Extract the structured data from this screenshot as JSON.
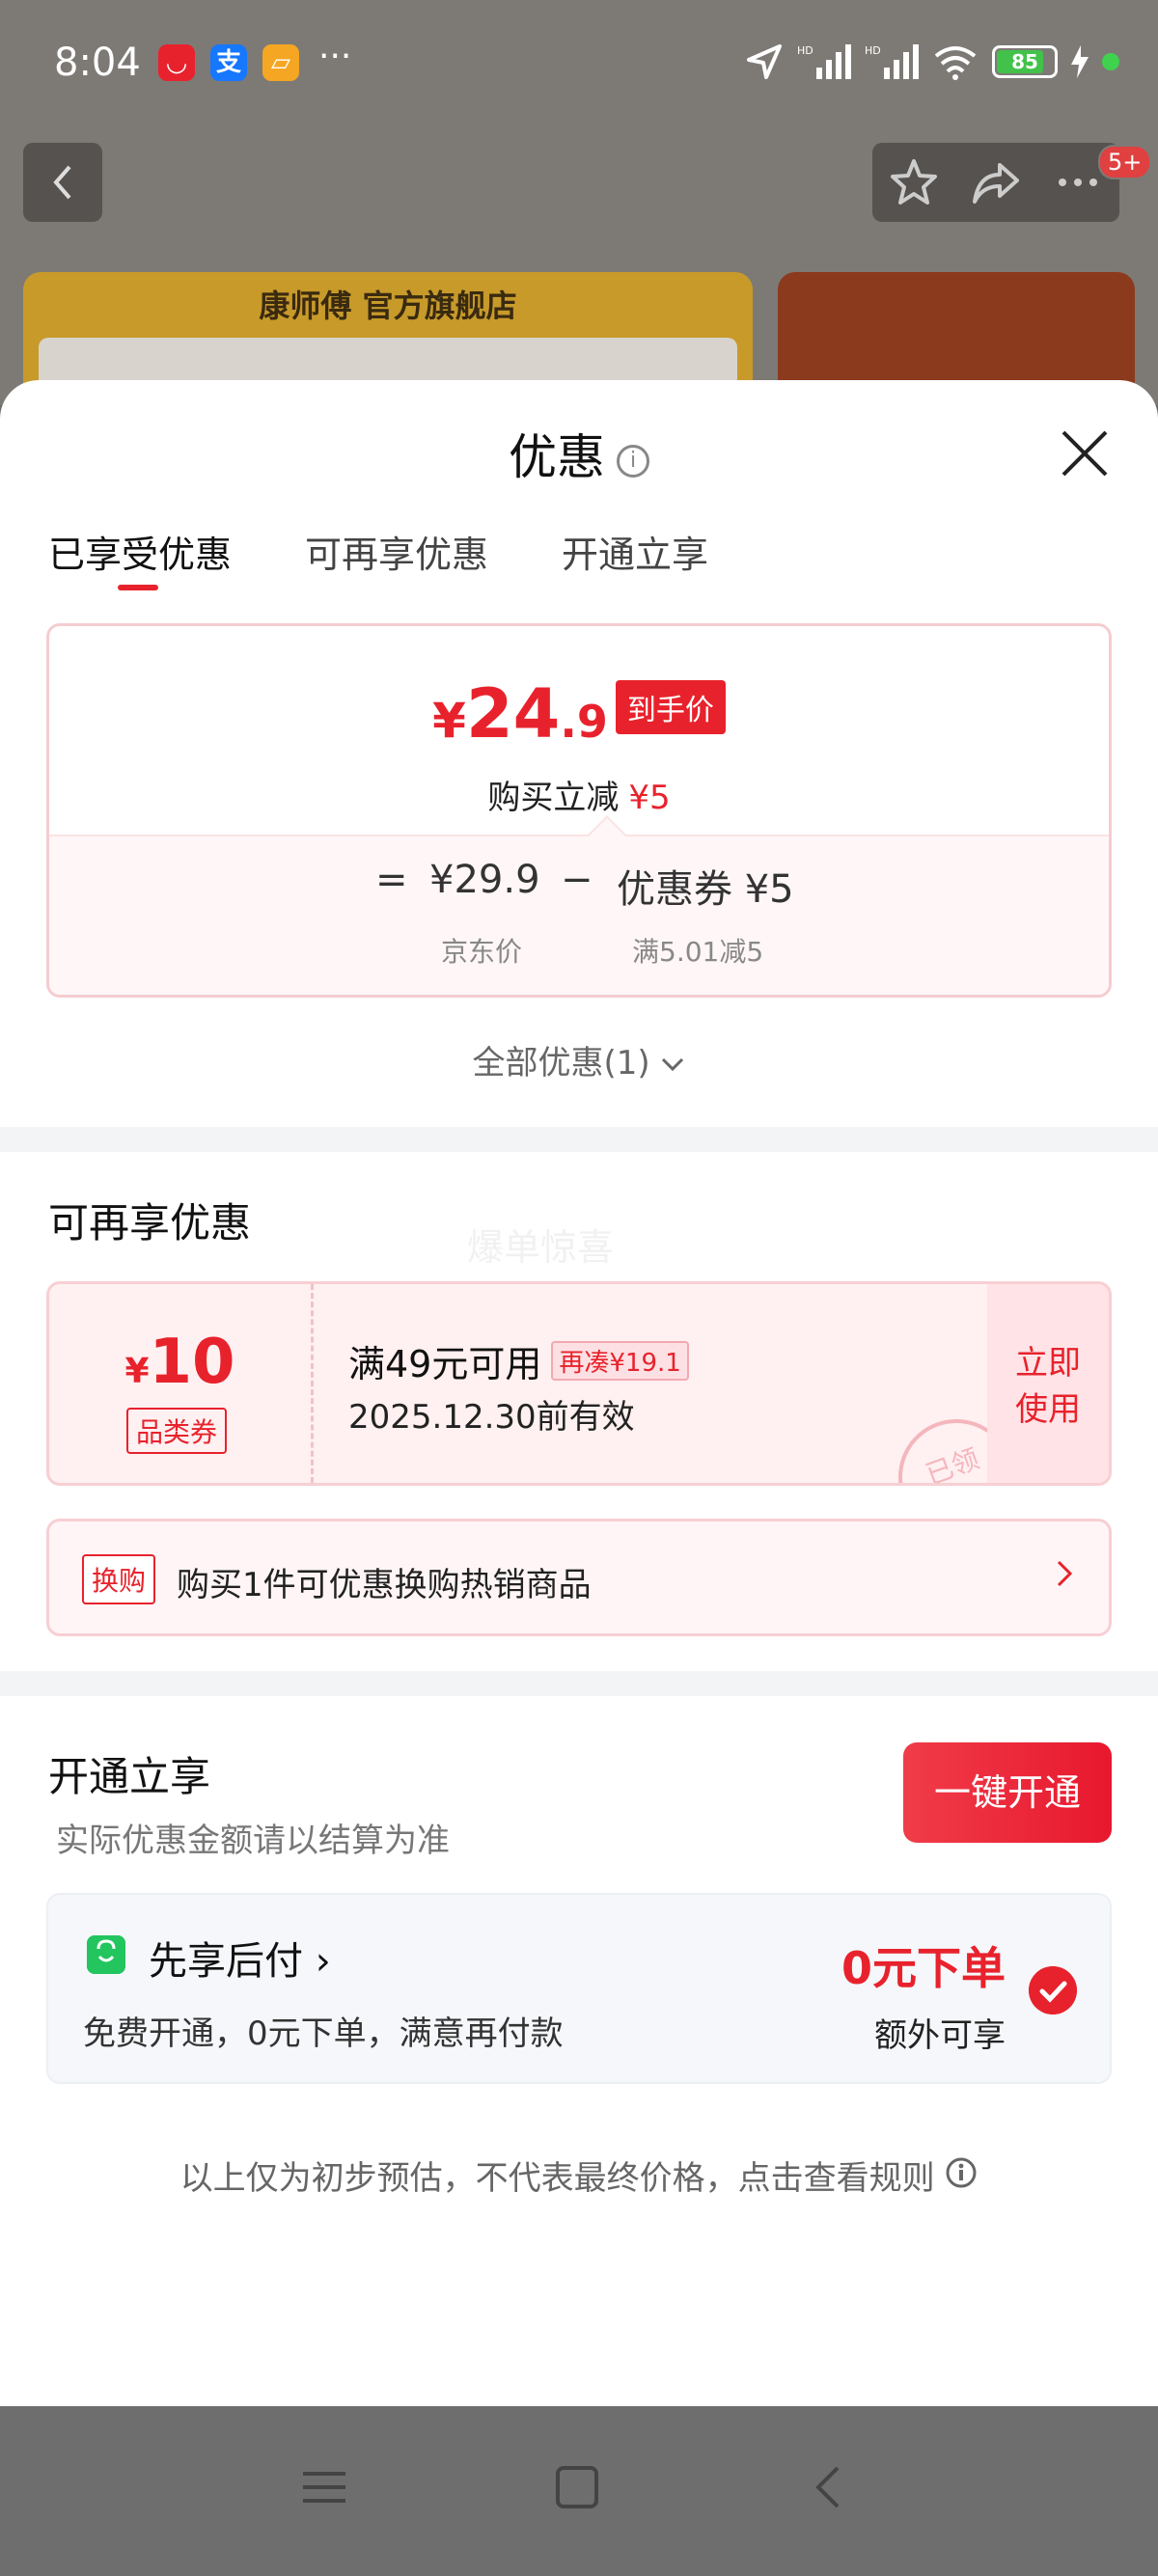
{
  "status_bar": {
    "time": "8:04",
    "battery": "85",
    "network": "HD"
  },
  "store": {
    "banner_title": "康师傅 官方旗舰店"
  },
  "nav": {
    "more_badge": "5+"
  },
  "sheet": {
    "title": "优惠",
    "tabs": [
      {
        "label": "已享受优惠"
      },
      {
        "label": "可再享优惠"
      },
      {
        "label": "开通立享"
      }
    ],
    "price_card": {
      "currency": "¥",
      "price_int": "24",
      "price_dec": ".9",
      "price_tag": "到手价",
      "reduce_label": "购买立减",
      "reduce_amount": "¥5",
      "calc_eq": "=",
      "calc_price": "¥29.9",
      "calc_minus": "−",
      "calc_coupon": "优惠券 ¥5",
      "calc_price_label": "京东价",
      "calc_coupon_label": "满5.01减5"
    },
    "all_link": "全部优惠(1)",
    "more_section": {
      "title": "可再享优惠",
      "watermark": "爆单惊喜",
      "coupon": {
        "currency": "¥",
        "value": "10",
        "type": "品类券",
        "condition": "满49元可用",
        "extra": "再凑¥19.1",
        "date": "2025.12.30前有效",
        "use_line1": "立即",
        "use_line2": "使用",
        "stamp": "已领"
      },
      "exchange": {
        "tag": "换购",
        "text": "购买1件可优惠换购热销商品"
      }
    },
    "open_section": {
      "title": "开通立享",
      "subtitle": "实际优惠金额请以结算为准",
      "button": "一键开通",
      "pay": {
        "title": "先享后付",
        "desc": "免费开通，0元下单，满意再付款",
        "price": "0元下单",
        "extra": "额外可享"
      }
    },
    "disclaimer": "以上仅为初步预估，不代表最终价格，点击查看规则"
  },
  "colors": {
    "accent": "#e8222c",
    "card_bg": "#fff0f1",
    "pay_green": "#22c55e"
  }
}
